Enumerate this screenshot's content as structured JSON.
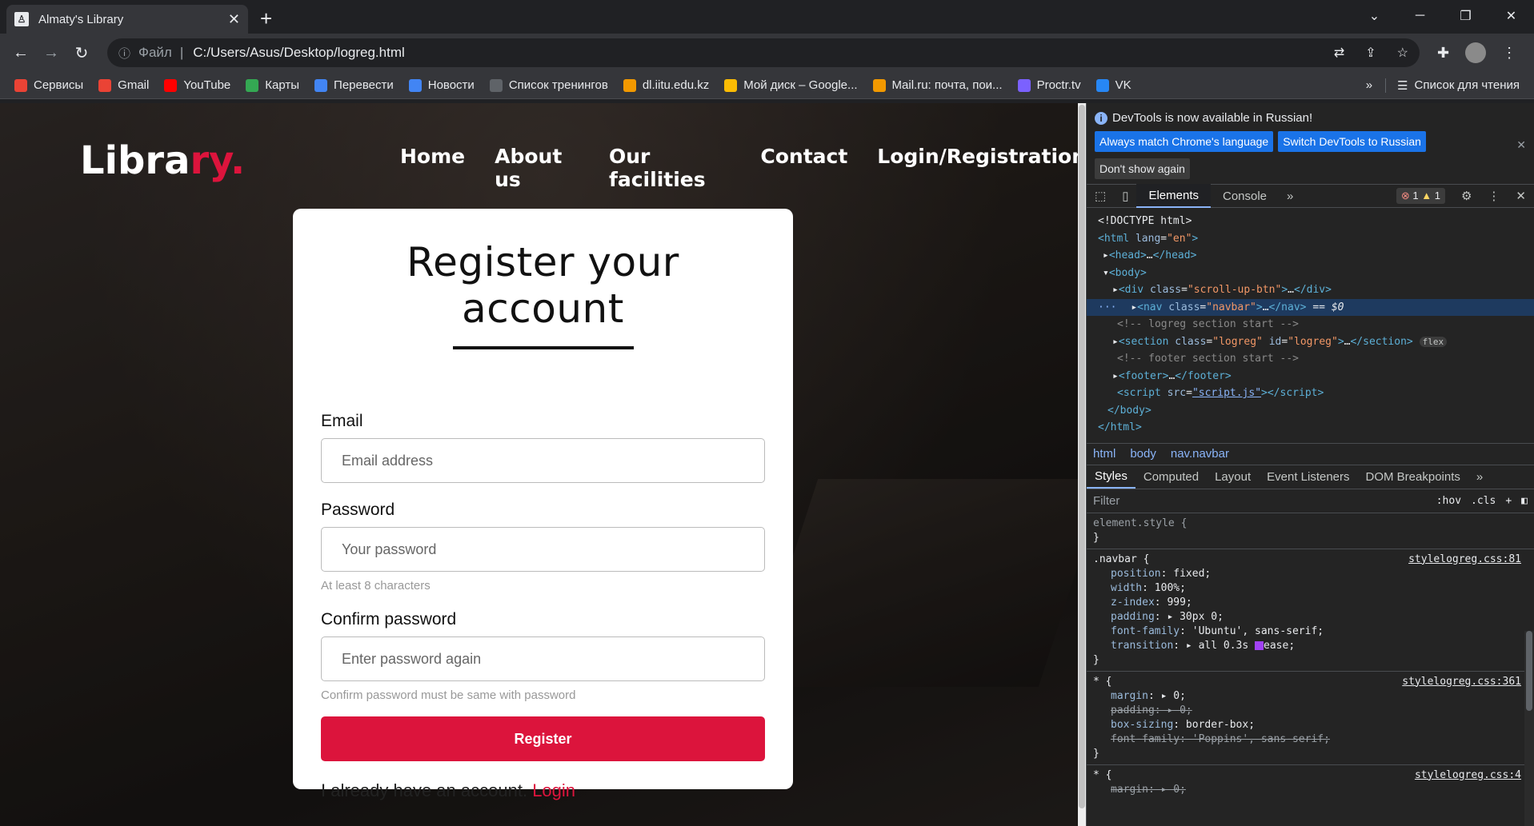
{
  "browser": {
    "tab_title": "Almaty's Library",
    "scheme_label": "Файл",
    "url": "C:/Users/Asus/Desktop/logreg.html",
    "bookmarks": [
      {
        "label": "Сервисы",
        "color": "#ea4335"
      },
      {
        "label": "Gmail",
        "color": "#ea4335"
      },
      {
        "label": "YouTube",
        "color": "#ff0000"
      },
      {
        "label": "Карты",
        "color": "#34a853"
      },
      {
        "label": "Перевести",
        "color": "#4285f4"
      },
      {
        "label": "Новости",
        "color": "#4285f4"
      },
      {
        "label": "Список тренингов",
        "color": "#5f6368"
      },
      {
        "label": "dl.iitu.edu.kz",
        "color": "#f29900"
      },
      {
        "label": "Мой диск – Google...",
        "color": "#fbbc04"
      },
      {
        "label": "Mail.ru: почта, пои...",
        "color": "#f29900"
      },
      {
        "label": "Proctr.tv",
        "color": "#7b61ff"
      },
      {
        "label": "VK",
        "color": "#2787f5"
      }
    ],
    "reading_list": "Список для чтения"
  },
  "site": {
    "logo_main": "Libra",
    "logo_accent": "ry.",
    "menu": [
      "Home",
      "About us",
      "Our facilities",
      "Contact",
      "Login/Registration"
    ],
    "accent_color": "#dc143c"
  },
  "form": {
    "title": "Register your account",
    "email_label": "Email",
    "email_placeholder": "Email address",
    "password_label": "Password",
    "password_placeholder": "Your password",
    "password_hint": "At least 8 characters",
    "confirm_label": "Confirm password",
    "confirm_placeholder": "Enter password again",
    "confirm_hint": "Confirm password must be same with password",
    "submit_label": "Register",
    "login_text": "I already have an account.",
    "login_link": "Login"
  },
  "devtools": {
    "info": "DevTools is now available in Russian!",
    "btn_match": "Always match Chrome's language",
    "btn_switch": "Switch DevTools to Russian",
    "btn_dont_show": "Don't show again",
    "tabs": [
      "Elements",
      "Console"
    ],
    "errors": "1",
    "warnings": "1",
    "breadcrumbs": [
      "html",
      "body",
      "nav.navbar"
    ],
    "sub_tabs": [
      "Styles",
      "Computed",
      "Layout",
      "Event Listeners",
      "DOM Breakpoints"
    ],
    "filter_placeholder": "Filter",
    "filter_opts": [
      ":hov",
      ".cls",
      "+"
    ]
  }
}
